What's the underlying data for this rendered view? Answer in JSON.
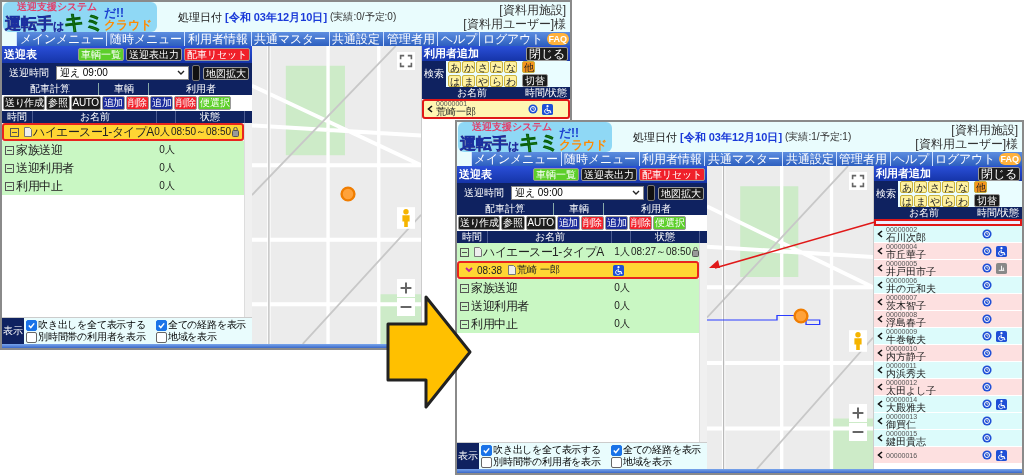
{
  "screens": [
    {
      "logo": {
        "caption": "送迎支援システム",
        "main": "運転手",
        "particle": "は",
        "highlight": "キミ",
        "end": "だ!!",
        "sub": "クラウド"
      },
      "date_label": "処理日付",
      "date": "[令和 03年12月10日]",
      "counts": "(実績:0/予定:0)",
      "facility": "[資料用施設]",
      "user": "[資料用ユーザー]様",
      "nav": [
        "メインメニュー",
        "随時メニュー",
        "利用者情報",
        "共通マスター",
        "共通設定",
        "管理者用",
        "ヘルプ",
        "ログアウト"
      ],
      "faq": "FAQ",
      "schedule": {
        "title": "送迎表",
        "title_buttons": [
          {
            "label": "車輌一覧",
            "kind": "green"
          },
          {
            "label": "送迎表出力",
            "kind": "black"
          },
          {
            "label": "配車リセット",
            "kind": "red"
          }
        ],
        "time_label": "送迎時間",
        "time_value": "迎え 09:00",
        "toggle_on": true,
        "map_button": "地図拡大",
        "sections": [
          "配車計算",
          "車輌",
          "利用者"
        ],
        "actions": [
          {
            "label": "送り作成",
            "kind": "black"
          },
          {
            "label": "参照",
            "kind": "black"
          },
          {
            "label": "AUTO",
            "kind": "black"
          },
          {
            "label": "追加",
            "kind": "navy"
          },
          {
            "label": "削除",
            "kind": "red"
          },
          {
            "label": "追加",
            "kind": "navy"
          },
          {
            "label": "削除",
            "kind": "red"
          },
          {
            "label": "便選択",
            "kind": "green"
          }
        ],
        "columns": [
          "時間",
          "お名前",
          "状態"
        ],
        "rows": [
          {
            "kind": "vehicle",
            "name": "ハイエースー1-タイプA",
            "count": "0人",
            "status": "08:50～08:50",
            "selected": true
          },
          {
            "kind": "group",
            "name": "家族送迎",
            "count": "0人",
            "selected": false
          },
          {
            "kind": "group",
            "name": "送迎利用者",
            "count": "0人",
            "selected": false
          },
          {
            "kind": "group",
            "name": "利用中止",
            "count": "0人",
            "selected": false
          }
        ]
      },
      "display": {
        "label": "表示",
        "options": [
          {
            "label": "吹き出しを全て表示する",
            "checked": true
          },
          {
            "label": "全ての経路を表示",
            "checked": true
          },
          {
            "label": "別時間帯の利用者を表示",
            "checked": false
          },
          {
            "label": "地域を表示",
            "checked": false
          }
        ]
      },
      "map": {
        "route": false
      },
      "users_panel": {
        "title": "利用者追加",
        "close": "閉じる",
        "search_label": "検索",
        "kana_row1": [
          "あ",
          "か",
          "さ",
          "た",
          "な"
        ],
        "other": "他",
        "kana_row2": [
          "は",
          "ま",
          "や",
          "ら",
          "わ"
        ],
        "switch": "切替",
        "columns": [
          "お名前",
          "時間/状態"
        ],
        "removed_slot": false,
        "items": [
          {
            "id": "00000001",
            "name": "荒崎一郎",
            "color": "#fff6b3",
            "selected": true,
            "clock": true,
            "wheelchair": true
          }
        ]
      }
    },
    {
      "logo": {
        "caption": "送迎支援システム",
        "main": "運転手",
        "particle": "は",
        "highlight": "キミ",
        "end": "だ!!",
        "sub": "クラウド"
      },
      "date_label": "処理日付",
      "date": "[令和 03年12月10日]",
      "counts": "(実績:1/予定:1)",
      "facility": "[資料用施設]",
      "user": "[資料用ユーザー]様",
      "nav": [
        "メインメニュー",
        "随時メニュー",
        "利用者情報",
        "共通マスター",
        "共通設定",
        "管理者用",
        "ヘルプ",
        "ログアウト"
      ],
      "faq": "FAQ",
      "schedule": {
        "title": "送迎表",
        "title_buttons": [
          {
            "label": "車輌一覧",
            "kind": "green"
          },
          {
            "label": "送迎表出力",
            "kind": "black"
          },
          {
            "label": "配車リセット",
            "kind": "red"
          }
        ],
        "time_label": "送迎時間",
        "time_value": "迎え 09:00",
        "toggle_on": true,
        "map_button": "地図拡大",
        "sections": [
          "配車計算",
          "車輌",
          "利用者"
        ],
        "actions": [
          {
            "label": "送り作成",
            "kind": "black"
          },
          {
            "label": "参照",
            "kind": "black"
          },
          {
            "label": "AUTO",
            "kind": "black"
          },
          {
            "label": "追加",
            "kind": "navy"
          },
          {
            "label": "削除",
            "kind": "red"
          },
          {
            "label": "追加",
            "kind": "navy"
          },
          {
            "label": "削除",
            "kind": "red"
          },
          {
            "label": "便選択",
            "kind": "green"
          }
        ],
        "columns": [
          "時間",
          "お名前",
          "状態"
        ],
        "rows": [
          {
            "kind": "vehicle",
            "name": "ハイエースー1-タイプA",
            "count": "1人",
            "status": "08:27～08:50",
            "selected": false
          },
          {
            "kind": "user",
            "time": "08:38",
            "name": "荒崎 一郎",
            "wheelchair": true,
            "selected": true
          },
          {
            "kind": "group",
            "name": "家族送迎",
            "count": "0人",
            "selected": false
          },
          {
            "kind": "group",
            "name": "送迎利用者",
            "count": "0人",
            "selected": false
          },
          {
            "kind": "group",
            "name": "利用中止",
            "count": "0人",
            "selected": false
          }
        ]
      },
      "display": {
        "label": "表示",
        "options": [
          {
            "label": "吹き出しを全て表示する",
            "checked": true
          },
          {
            "label": "全ての経路を表示",
            "checked": true
          },
          {
            "label": "別時間帯の利用者を表示",
            "checked": false
          },
          {
            "label": "地域を表示",
            "checked": false
          }
        ]
      },
      "map": {
        "route": true
      },
      "users_panel": {
        "title": "利用者追加",
        "close": "閉じる",
        "search_label": "検索",
        "kana_row1": [
          "あ",
          "か",
          "さ",
          "た",
          "な"
        ],
        "other": "他",
        "kana_row2": [
          "は",
          "ま",
          "や",
          "ら",
          "わ"
        ],
        "switch": "切替",
        "columns": [
          "お名前",
          "時間/状態"
        ],
        "removed_slot": true,
        "items": [
          {
            "id": "00000002",
            "name": "石川次郎",
            "color": "#dcfbfb",
            "selected": false,
            "clock": true,
            "wheelchair": false
          },
          {
            "id": "00000004",
            "name": "市丘華子",
            "color": "#fde0e0",
            "selected": false,
            "clock": true,
            "wheelchair": true
          },
          {
            "id": "00000005",
            "name": "井戸田市子",
            "color": "#fde0e0",
            "selected": false,
            "clock": true,
            "wheelchair": false,
            "walker": true
          },
          {
            "id": "00000006",
            "name": "井の元和夫",
            "color": "#dcfbfb",
            "selected": false,
            "clock": true,
            "wheelchair": false
          },
          {
            "id": "00000007",
            "name": "茨木智子",
            "color": "#fde0e0",
            "selected": false,
            "clock": true,
            "wheelchair": false
          },
          {
            "id": "00000008",
            "name": "浮島春子",
            "color": "#fde0e0",
            "selected": false,
            "clock": true,
            "wheelchair": false
          },
          {
            "id": "00000009",
            "name": "牛巻敏夫",
            "color": "#dcfbfb",
            "selected": false,
            "clock": true,
            "wheelchair": true
          },
          {
            "id": "00000010",
            "name": "内方静子",
            "color": "#fde0e0",
            "selected": false,
            "clock": true,
            "wheelchair": false
          },
          {
            "id": "00000011",
            "name": "内浜秀夫",
            "color": "#dcfbfb",
            "selected": false,
            "clock": true,
            "wheelchair": false
          },
          {
            "id": "00000012",
            "name": "太田よし子",
            "color": "#fde0e0",
            "selected": false,
            "clock": true,
            "wheelchair": false
          },
          {
            "id": "00000014",
            "name": "大殿雅夫",
            "color": "#dcfbfb",
            "selected": false,
            "clock": true,
            "wheelchair": true
          },
          {
            "id": "00000013",
            "name": "御買仁",
            "color": "#dcfbfb",
            "selected": false,
            "clock": true,
            "wheelchair": false
          },
          {
            "id": "00000015",
            "name": "鍵田貴志",
            "color": "#dcfbfb",
            "selected": false,
            "clock": true,
            "wheelchair": false
          },
          {
            "id": "00000016",
            "color": "#fde0e0",
            "selected": false,
            "clock": true,
            "wheelchair": true
          }
        ]
      }
    }
  ]
}
